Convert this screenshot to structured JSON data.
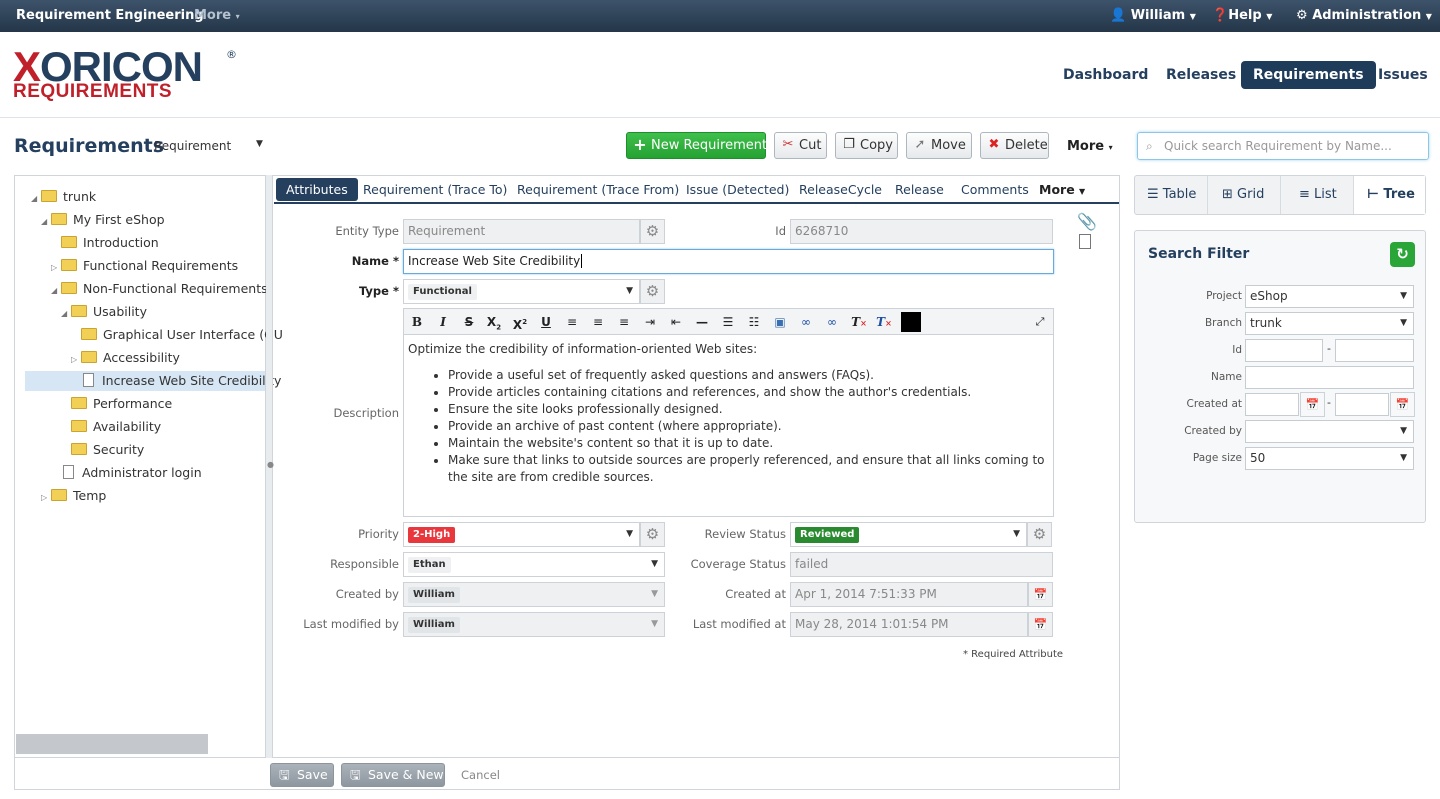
{
  "topbar": {
    "app_name": "Requirement Engineering",
    "more": "More",
    "user": "William",
    "help": "Help",
    "admin": "Administration"
  },
  "logo": {
    "brand": "XORICON",
    "sub": "REQUIREMENTS",
    "reg": "®"
  },
  "nav": [
    "Dashboard",
    "Releases",
    "Requirements",
    "Issues"
  ],
  "nav_active": "Requirements",
  "toolbar": {
    "title": "Requirements",
    "type_select": "Requirement",
    "new": "New Requirement",
    "cut": "Cut",
    "copy": "Copy",
    "move": "Move",
    "delete": "Delete",
    "more": "More",
    "search_placeholder": "Quick search Requirement by Name..."
  },
  "tree": [
    {
      "label": "trunk",
      "kind": "folder",
      "level": 0,
      "expander": "open"
    },
    {
      "label": "My First eShop",
      "kind": "folder",
      "level": 1,
      "expander": "open"
    },
    {
      "label": "Introduction",
      "kind": "folder",
      "level": 2,
      "expander": "none"
    },
    {
      "label": "Functional Requirements",
      "kind": "folder",
      "level": 2,
      "expander": "closed"
    },
    {
      "label": "Non-Functional Requirements",
      "kind": "folder",
      "level": 2,
      "expander": "open"
    },
    {
      "label": "Usability",
      "kind": "folder",
      "level": 3,
      "expander": "open"
    },
    {
      "label": "Graphical User Interface (GU",
      "kind": "folder",
      "level": 4,
      "expander": "none"
    },
    {
      "label": "Accessibility",
      "kind": "folder",
      "level": 4,
      "expander": "closed"
    },
    {
      "label": "Increase Web Site Credibility",
      "kind": "doc",
      "level": 4,
      "expander": "none",
      "selected": true
    },
    {
      "label": "Performance",
      "kind": "folder",
      "level": 3,
      "expander": "none"
    },
    {
      "label": "Availability",
      "kind": "folder",
      "level": 3,
      "expander": "none"
    },
    {
      "label": "Security",
      "kind": "folder",
      "level": 3,
      "expander": "none"
    },
    {
      "label": "Administrator login",
      "kind": "doc",
      "level": 2,
      "expander": "none"
    },
    {
      "label": "Temp",
      "kind": "folder",
      "level": 1,
      "expander": "closed"
    }
  ],
  "tabs": [
    "Attributes",
    "Requirement (Trace To)",
    "Requirement (Trace From)",
    "Issue (Detected)",
    "ReleaseCycle",
    "Release",
    "Comments",
    "More"
  ],
  "form": {
    "entity_type_label": "Entity Type",
    "entity_type": "Requirement",
    "id_label": "Id",
    "id": "6268710",
    "name_label": "Name",
    "name": "Increase Web Site Credibility",
    "type_label": "Type",
    "type": "Functional",
    "description_label": "Description",
    "description_intro": "Optimize the credibility of information-oriented Web sites:",
    "description_items": [
      "Provide a useful set of frequently asked questions and answers (FAQs).",
      "Provide articles containing citations and references, and show the author's credentials.",
      "Ensure the site looks professionally designed.",
      "Provide an archive of past content (where appropriate).",
      "Maintain the website's content so that it is up to date.",
      "Make sure that links to outside sources are properly referenced, and ensure that all links coming to the site are from credible sources."
    ],
    "priority_label": "Priority",
    "priority": "2-High",
    "priority_color": "#e8383d",
    "review_label": "Review Status",
    "review": "Reviewed",
    "review_color": "#2a8a2f",
    "responsible_label": "Responsible",
    "responsible": "Ethan",
    "coverage_label": "Coverage Status",
    "coverage": "failed",
    "created_by_label": "Created by",
    "created_by": "William",
    "created_at_label": "Created at",
    "created_at": "Apr 1, 2014 7:51:33 PM",
    "modified_by_label": "Last modified by",
    "modified_by": "William",
    "modified_at_label": "Last modified at",
    "modified_at": "May 28, 2014 1:01:54 PM",
    "required_note": "* Required Attribute",
    "req_star": "*"
  },
  "views": [
    "Table",
    "Grid",
    "List",
    "Tree"
  ],
  "view_active": "Tree",
  "filter": {
    "title": "Search Filter",
    "project_label": "Project",
    "project": "eShop",
    "branch_label": "Branch",
    "branch": "trunk",
    "id_label": "Id",
    "name_label": "Name",
    "created_at_label": "Created at",
    "created_by_label": "Created by",
    "page_size_label": "Page size",
    "page_size": "50",
    "dash": "-"
  },
  "bottom": {
    "save": "Save",
    "save_new": "Save & New",
    "cancel": "Cancel"
  },
  "colors": {
    "brand": "#25405f",
    "accent_red": "#c0202a",
    "new_button": "#2aa638"
  }
}
